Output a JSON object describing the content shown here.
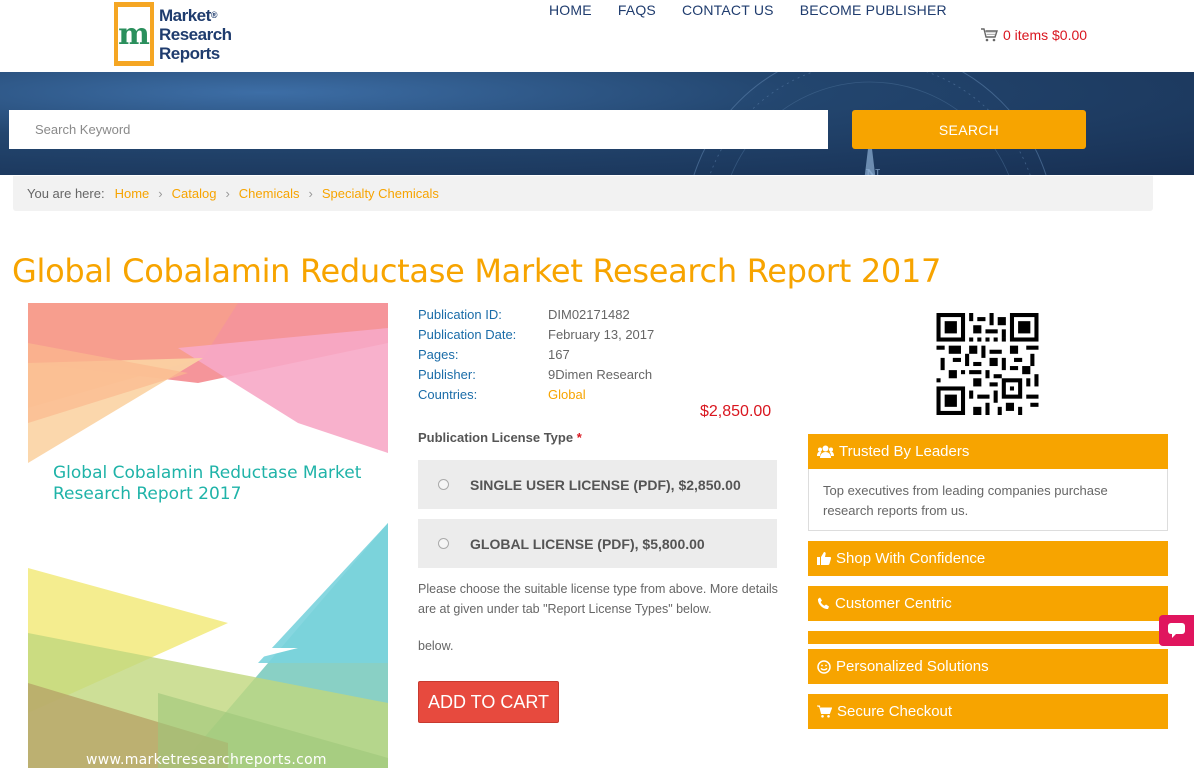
{
  "header": {
    "logo_line1": "Market",
    "logo_line2": "Research",
    "logo_line3": "Reports",
    "logo_mark": "m",
    "nav": [
      "HOME",
      "FAQS",
      "CONTACT US",
      "BECOME PUBLISHER"
    ],
    "cart_label": "0 items $0.00",
    "cart_icon": "shopping-cart-icon"
  },
  "search": {
    "placeholder": "Search Keyword",
    "button_label": "SEARCH"
  },
  "breadcrumb": {
    "prefix": "You are here:",
    "items": [
      "Home",
      "Catalog",
      "Chemicals",
      "Specialty Chemicals"
    ],
    "separator": "›"
  },
  "product": {
    "title": "Global Cobalamin Reductase Market Research Report 2017",
    "cover_title": "Global Cobalamin Reductase Market Research Report 2017",
    "cover_url": "www.marketresearchreports.com",
    "meta": [
      {
        "key": "Publication ID:",
        "value": "DIM02171482"
      },
      {
        "key": "Publication Date:",
        "value": "February 13, 2017"
      },
      {
        "key": "Pages:",
        "value": "167"
      },
      {
        "key": "Publisher:",
        "value": "9Dimen Research"
      },
      {
        "key": "Countries:",
        "value": "Global"
      }
    ],
    "price": "$2,850.00",
    "license_label": "Publication License Type",
    "license_required_mark": "*",
    "licenses": [
      "SINGLE USER LICENSE (PDF), $2,850.00",
      "GLOBAL LICENSE (PDF), $5,800.00"
    ],
    "help_text": "Please choose the suitable license type from above. More details are at given under tab \"Report License Types\" below.",
    "help_text_dup": "below.",
    "add_to_cart": "ADD TO CART"
  },
  "sidebar": {
    "trusted_title": "Trusted By Leaders",
    "trusted_body": "Top executives from leading companies purchase research reports from us.",
    "panels": [
      {
        "label": "Shop With Confidence",
        "icon": "thumbs-up-icon"
      },
      {
        "label": "Customer Centric",
        "icon": "phone-icon"
      },
      {
        "label": "Personalized Solutions",
        "icon": "smile-icon"
      },
      {
        "label": "Secure Checkout",
        "icon": "cart-icon"
      }
    ]
  },
  "colors": {
    "accent": "#f7a400",
    "link_blue": "#1a6ca8",
    "price_red": "#d9161f",
    "nav_blue": "#1f3c6e",
    "add_to_cart": "#e74a3e",
    "chat": "#e0155e"
  }
}
